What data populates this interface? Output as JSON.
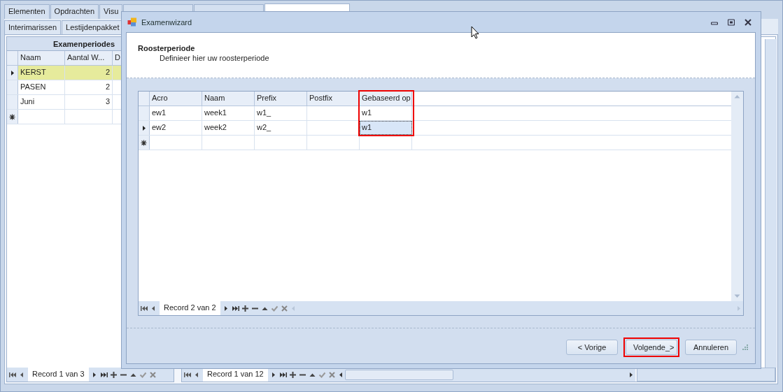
{
  "tabs": [
    {
      "label": "Elementen",
      "selected": false
    },
    {
      "label": "Opdrachten",
      "selected": false
    },
    {
      "label": "Visu",
      "selected": false
    },
    {
      "selected": false
    },
    {
      "selected": false
    },
    {
      "selected": true
    }
  ],
  "subtabs": [
    "Interimarissen",
    "Lestijdenpakket"
  ],
  "background_grid": {
    "title": "Examenperiodes",
    "columns": [
      "Naam",
      "Aantal W...",
      "D"
    ],
    "rows": [
      {
        "cells": [
          "KERST",
          "2"
        ],
        "selected": true
      },
      {
        "cells": [
          "PASEN",
          "2"
        ],
        "selected": false
      },
      {
        "cells": [
          "Juni",
          "3"
        ],
        "selected": false
      }
    ],
    "navigator": "Record 1 van 3"
  },
  "background_navigator": "Record 1 van 12",
  "dialog": {
    "title": "Examenwizard",
    "heading": "Roosterperiode",
    "subtitle": "Definieer hier uw roosterperiode",
    "grid": {
      "columns": [
        {
          "label": "Acro",
          "highlighted": false
        },
        {
          "label": "Naam",
          "highlighted": false
        },
        {
          "label": "Prefix",
          "highlighted": false
        },
        {
          "label": "Postfix",
          "highlighted": false
        },
        {
          "label": "Gebaseerd op",
          "highlighted": true
        }
      ],
      "rows": [
        {
          "cells": [
            "ew1",
            "week1",
            "w1_",
            null,
            "w1"
          ],
          "current": false
        },
        {
          "cells": [
            "ew2",
            "week2",
            "w2_",
            null,
            "w1"
          ],
          "current": true
        }
      ],
      "navigator": "Record 2 van 2"
    },
    "buttons": [
      {
        "label": "< Vorige",
        "highlighted": false
      },
      {
        "label": "Volgende_>",
        "highlighted": true
      },
      {
        "label": "Annuleren",
        "highlighted": false
      }
    ]
  }
}
